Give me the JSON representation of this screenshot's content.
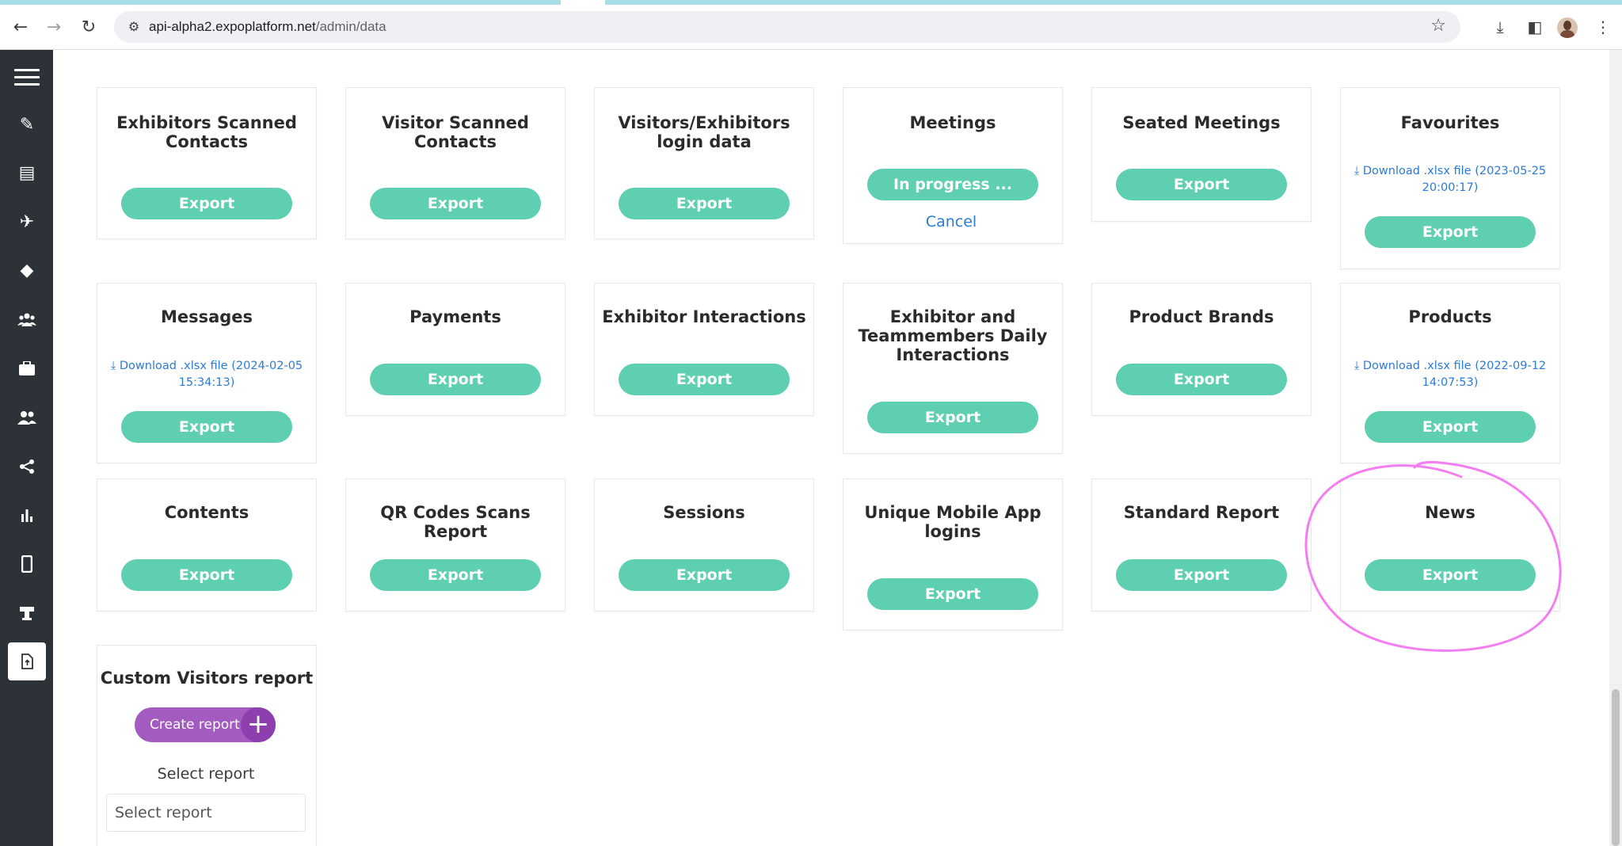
{
  "browser": {
    "url_host": "api-alpha2.expoplatform.net",
    "url_path": "/admin/data"
  },
  "sidebar": {
    "items": [
      {
        "icon": "hamburger-menu-icon"
      },
      {
        "icon": "pencil-icon"
      },
      {
        "icon": "list-icon"
      },
      {
        "icon": "airplane-icon"
      },
      {
        "icon": "diamond-icon"
      },
      {
        "icon": "group-icon"
      },
      {
        "icon": "briefcase-icon"
      },
      {
        "icon": "people-icon"
      },
      {
        "icon": "share-icon"
      },
      {
        "icon": "bar-chart-icon"
      },
      {
        "icon": "mobile-icon"
      },
      {
        "icon": "kiosk-icon"
      },
      {
        "icon": "file-export-icon",
        "active": true
      }
    ]
  },
  "export_label": "Export",
  "colors": {
    "export_button": "#5ecfb1",
    "link": "#2b7bd6",
    "create_button": "#a45bc0",
    "sidebar": "#2d3138",
    "annotation": "#f27ef0"
  },
  "cards": {
    "exhibitors_scanned": {
      "title_line1": "Exhibitors Scanned",
      "title_line2": "Contacts"
    },
    "visitor_scanned": {
      "title_line1": "Visitor Scanned",
      "title_line2": "Contacts"
    },
    "login_data": {
      "title_line1": "Visitors/Exhibitors",
      "title_line2": "login data"
    },
    "meetings": {
      "title": "Meetings",
      "button": "In progress ...",
      "cancel": "Cancel"
    },
    "seated_meetings": {
      "title": "Seated Meetings"
    },
    "favourites": {
      "title": "Favourites",
      "download_line1": "Download .xlsx file (2023-05-25",
      "download_line2": "20:00:17)"
    },
    "messages": {
      "title": "Messages",
      "download_line1": "Download .xlsx file (2024-02-05",
      "download_line2": "15:34:13)"
    },
    "payments": {
      "title": "Payments"
    },
    "exhibitor_interactions": {
      "title": "Exhibitor Interactions"
    },
    "exhibitor_teammembers": {
      "title_line1": "Exhibitor and",
      "title_line2": "Teammembers Daily",
      "title_line3": "Interactions"
    },
    "product_brands": {
      "title": "Product Brands"
    },
    "products": {
      "title": "Products",
      "download_line1": "Download .xlsx file (2022-09-12",
      "download_line2": "14:07:53)"
    },
    "contents": {
      "title": "Contents"
    },
    "qr_codes": {
      "title": "QR Codes Scans Report"
    },
    "sessions": {
      "title": "Sessions"
    },
    "unique_mobile": {
      "title_line1": "Unique Mobile App",
      "title_line2": "logins"
    },
    "standard_report": {
      "title": "Standard Report"
    },
    "news": {
      "title": "News"
    },
    "custom_visitors": {
      "title": "Custom Visitors report",
      "create_label": "Create report",
      "select_label": "Select report",
      "select_placeholder": "Select report"
    }
  }
}
